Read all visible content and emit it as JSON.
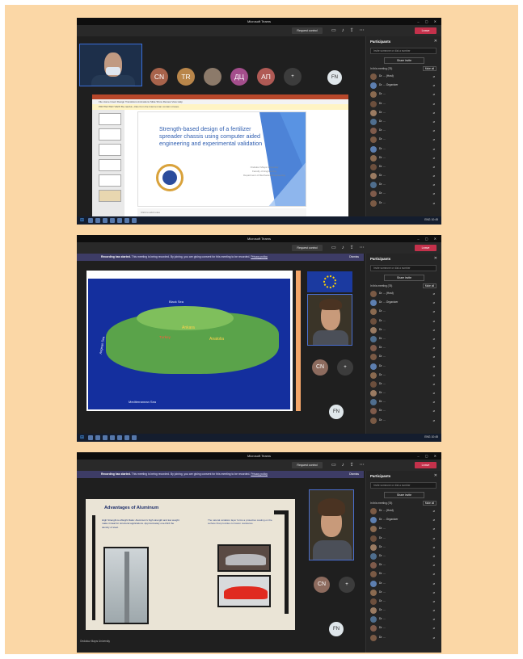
{
  "colors": {
    "background": "#fbd7a6",
    "teams_dark": "#1f1f1f",
    "leave": "#c4314b",
    "recording_bar": "#3d3c66",
    "slide_title": "#2f5eb0"
  },
  "app": {
    "title": "Microsoft Teams",
    "time": "",
    "request_control": "Request control",
    "leave_label": "Leave",
    "toolbar_icons": [
      "camera-icon",
      "mic-icon",
      "share-icon",
      "more-icon"
    ]
  },
  "recording": {
    "bold": "Recording has started.",
    "text": "This meeting is being recorded. By joining, you are giving consent for this meeting to be recorded.",
    "link": "Privacy policy",
    "dismiss": "Dismiss"
  },
  "participants_panel": {
    "title": "Participants",
    "search_placeholder": "Invite someone or dial a number",
    "share_invite": "Share invite",
    "in_meeting": "In this meeting (78)",
    "mute_all": "Mute all",
    "rows": [
      "Dr. ... (Host)",
      "Dr. ... Organizer",
      "Dr. ...",
      "Dr. ...",
      "Dr. ...",
      "Dr. ...",
      "Dr. ...",
      "Dr. ...",
      "Dr. ...",
      "Dr. ...",
      "Dr. ...",
      "Dr. ...",
      "Dr. ...",
      "Dr. ...",
      "Dr. ..."
    ]
  },
  "shot1": {
    "avatars": [
      {
        "initials": "CN",
        "color": "#a8634b"
      },
      {
        "initials": "TR",
        "color": "#b9864a"
      },
      {
        "initials": "",
        "color": "#8c7a6a"
      },
      {
        "initials": "ДЦ",
        "color": "#a44e8c"
      },
      {
        "initials": "AП",
        "color": "#b05a55"
      }
    ],
    "overflow": "+",
    "fn": "FN",
    "ppt_menus": "File Home Insert Design Transitions Animations Slide Show Review View Help",
    "ppt_warning": "PROTECTED VIEW Be careful—files from the Internet can contain viruses.",
    "slide_title": "Strength-based design of a fertilizer spreader chassis using computer aided engineering and experimental validation",
    "slide_info": [
      "Ondokuz Mayıs University",
      "Faculty of Engineering",
      "Department of Mechanical Engineering"
    ],
    "notes": "Click to add notes"
  },
  "shot2": {
    "map_labels": [
      {
        "text": "Black Sea",
        "cls": ""
      },
      {
        "text": "Ankara",
        "cls": "gold"
      },
      {
        "text": "Turkey",
        "cls": "red"
      },
      {
        "text": "Anatolia",
        "cls": "gold"
      },
      {
        "text": "Aegean Sea",
        "cls": ""
      },
      {
        "text": "Mediterranean Sea",
        "cls": ""
      }
    ],
    "fn": "FN",
    "cn": "CN"
  },
  "shot3": {
    "title": "Advantages of Aluminum",
    "left_text": "High Strength-to-Weight Ratio: Aluminum's high strength and low weight make it ideal for structural applications. Approximately one-third the density of steel.",
    "right_text": "The natural oxidation layer forms a protective coating on the surface that provides corrosion resistance.",
    "cn": "CN",
    "fn": "FN",
    "presenter": "Ondokuz Mayıs University"
  },
  "taskbar": {
    "tray_text": "ENG 10:45"
  }
}
